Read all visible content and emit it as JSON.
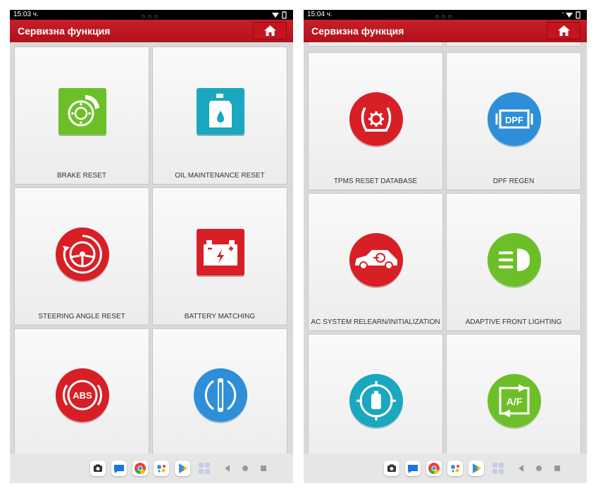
{
  "left": {
    "status": {
      "time": "15:03 ч."
    },
    "header": {
      "title": "Сервизна функция"
    },
    "cards": [
      {
        "label": "BRAKE RESET",
        "icon": "brake-disc-icon",
        "color": "#6dbf2a"
      },
      {
        "label": "OIL MAINTENANCE RESET",
        "icon": "oil-bottle-icon",
        "color": "#19a8bf"
      },
      {
        "label": "STEERING ANGLE RESET",
        "icon": "steering-wheel-icon",
        "color": "#d81f26"
      },
      {
        "label": "BATTERY MATCHING",
        "icon": "battery-icon",
        "color": "#d81f26"
      },
      {
        "label": "",
        "icon": "abs-icon",
        "color": "#d81f26"
      },
      {
        "label": "",
        "icon": "injector-icon",
        "color": "#2e8fd8"
      }
    ]
  },
  "right": {
    "status": {
      "time": "15:04 ч."
    },
    "header": {
      "title": "Сервизна функция"
    },
    "cards": [
      {
        "label": "TPMS RESET DATABASE",
        "icon": "tpms-icon",
        "color": "#d81f26"
      },
      {
        "label": "DPF REGEN",
        "icon": "dpf-icon",
        "color": "#2e8fd8",
        "icon_text": "DPF"
      },
      {
        "label": "AC SYSTEM RELEARN/INITIALIZATION",
        "icon": "ac-car-icon",
        "color": "#d81f26"
      },
      {
        "label": "ADAPTIVE FRONT LIGHTING",
        "icon": "headlight-icon",
        "color": "#6dbf2a"
      },
      {
        "label": "",
        "icon": "level-sensor-icon",
        "color": "#19a8bf"
      },
      {
        "label": "",
        "icon": "af-icon",
        "color": "#6dbf2a",
        "icon_text": "A/F"
      }
    ]
  },
  "colors": {
    "header": "#c0141f",
    "background": "#d9d9d9"
  },
  "nav_icons": [
    "camera-icon",
    "messages-icon",
    "chrome-icon",
    "assistant-icon",
    "play-store-icon",
    "apps-grid-icon",
    "back-icon",
    "home-nav-icon",
    "recents-icon"
  ]
}
